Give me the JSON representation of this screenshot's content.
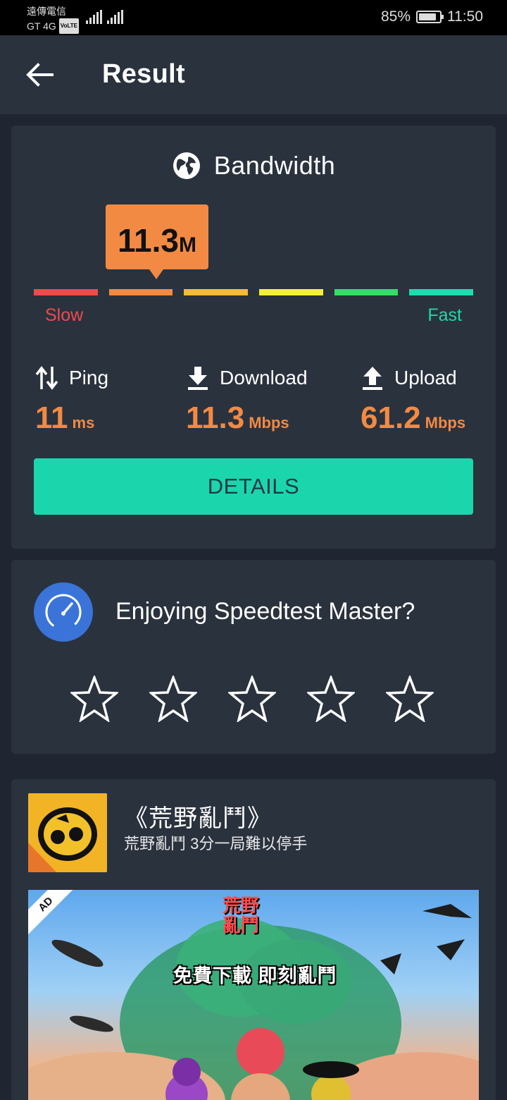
{
  "status_bar": {
    "carrier": "遠傳電信",
    "network": "GT 4G",
    "volte": "VoLTE",
    "battery": "85%",
    "time": "11:50"
  },
  "appbar": {
    "title": "Result"
  },
  "bandwidth": {
    "title": "Bandwidth",
    "value": "11.3",
    "unit": "M",
    "scale_colors": [
      "#ee4b4d",
      "#f28a44",
      "#f6ba3a",
      "#f4f03a",
      "#35dc6a",
      "#1fdcb0"
    ],
    "slow_label": "Slow",
    "fast_label": "Fast"
  },
  "metrics": {
    "ping": {
      "label": "Ping",
      "value": "11",
      "unit": "ms"
    },
    "download": {
      "label": "Download",
      "value": "11.3",
      "unit": "Mbps"
    },
    "upload": {
      "label": "Upload",
      "value": "61.2",
      "unit": "Mbps"
    }
  },
  "details_button": "DETAILS",
  "rating": {
    "question": "Enjoying Speedtest Master?",
    "stars": 5
  },
  "ad": {
    "title": "《荒野亂鬥》",
    "subtitle": "荒野亂鬥 3分一局難以停手",
    "badge": "AD",
    "banner_logo_line1": "荒野",
    "banner_logo_line2": "亂鬥",
    "banner_tagline": "免費下載 即刻亂鬥"
  },
  "colors": {
    "accent": "#1bd6ad",
    "orange": "#f28a44",
    "background": "#1f2631",
    "card": "#2a323e"
  }
}
